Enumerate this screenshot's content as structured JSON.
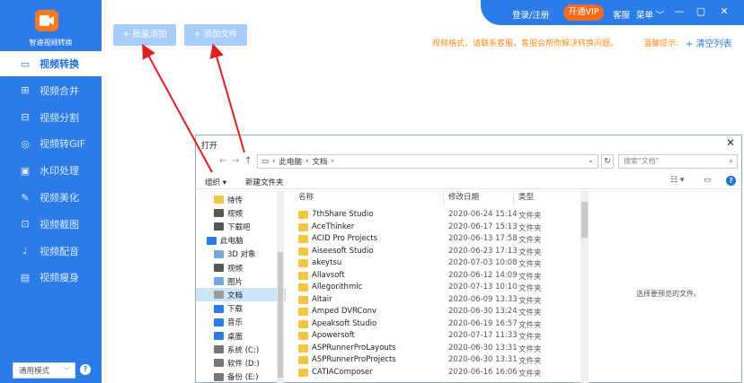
{
  "app": {
    "name": "智速视频转换",
    "nav": [
      {
        "label": "视频转换",
        "icon": "video-icon",
        "active": true
      },
      {
        "label": "视频合并",
        "icon": "merge-icon"
      },
      {
        "label": "视频分割",
        "icon": "split-icon"
      },
      {
        "label": "视频转GIF",
        "icon": "gif-icon"
      },
      {
        "label": "水印处理",
        "icon": "watermark-icon"
      },
      {
        "label": "视频美化",
        "icon": "beautify-icon"
      },
      {
        "label": "视频截图",
        "icon": "screenshot-icon"
      },
      {
        "label": "视频配音",
        "icon": "mic-icon"
      },
      {
        "label": "视频瘦身",
        "icon": "compress-icon"
      }
    ],
    "mode": "通用模式",
    "help": "?"
  },
  "topbar": {
    "login": "登录/注册",
    "vip": "开通VIP",
    "service": "客服",
    "menu": "菜单"
  },
  "main": {
    "batch_add": "+ 批量添加",
    "add_file": "+ 添加文件",
    "notice": "视频格式，请联系客服，客服会帮你解决转换问题。",
    "tip": "温馨提示:",
    "clear": "+ 清空列表"
  },
  "dialog": {
    "title": "打开",
    "path": [
      "此电脑",
      "文档"
    ],
    "search_placeholder": "搜索\"文档\"",
    "organize": "组织 ▾",
    "new_folder": "新建文件夹",
    "tree": [
      {
        "label": "待传",
        "color": "#f4c542"
      },
      {
        "label": "视频",
        "color": "#555"
      },
      {
        "label": "下载吧",
        "color": "#555"
      },
      {
        "label": "此电脑",
        "color": "#2c7ce8"
      },
      {
        "label": "3D 对象",
        "color": "#6fa8dc"
      },
      {
        "label": "视频",
        "color": "#555"
      },
      {
        "label": "图片",
        "color": "#6fa8dc"
      },
      {
        "label": "文档",
        "color": "#999",
        "selected": true
      },
      {
        "label": "下载",
        "color": "#2c7ce8"
      },
      {
        "label": "音乐",
        "color": "#2c7ce8"
      },
      {
        "label": "桌面",
        "color": "#2c7ce8"
      },
      {
        "label": "系统 (C:)",
        "color": "#777"
      },
      {
        "label": "软件 (D:)",
        "color": "#777"
      },
      {
        "label": "备份 (E:)",
        "color": "#777"
      }
    ],
    "columns": {
      "name": "名称",
      "date": "修改日期",
      "type": "类型"
    },
    "files": [
      {
        "name": "7thShare Studio",
        "date": "2020-06-24 15:14",
        "type": "文件夹"
      },
      {
        "name": "AceThinker",
        "date": "2020-06-17 15:13",
        "type": "文件夹"
      },
      {
        "name": "ACID Pro Projects",
        "date": "2020-06-13 17:58",
        "type": "文件夹"
      },
      {
        "name": "Aiseesoft Studio",
        "date": "2020-06-23 17:13",
        "type": "文件夹"
      },
      {
        "name": "akeytsu",
        "date": "2020-07-03 10:08",
        "type": "文件夹"
      },
      {
        "name": "Allavsoft",
        "date": "2020-06-12 14:09",
        "type": "文件夹"
      },
      {
        "name": "Allegorithmic",
        "date": "2020-07-13 10:10",
        "type": "文件夹"
      },
      {
        "name": "Altair",
        "date": "2020-06-09 13:33",
        "type": "文件夹"
      },
      {
        "name": "Amped DVRConv",
        "date": "2020-06-30 13:24",
        "type": "文件夹"
      },
      {
        "name": "Apeaksoft Studio",
        "date": "2020-06-19 16:57",
        "type": "文件夹"
      },
      {
        "name": "Apowersoft",
        "date": "2020-07-17 11:33",
        "type": "文件夹"
      },
      {
        "name": "ASPRunnerProLayouts",
        "date": "2020-06-30 13:31",
        "type": "文件夹"
      },
      {
        "name": "ASPRunnerProProjects",
        "date": "2020-06-30 13:31",
        "type": "文件夹"
      },
      {
        "name": "CATIAComposer",
        "date": "2020-06-16 16:06",
        "type": "文件夹"
      }
    ],
    "preview_text": "选择要预览的文件。"
  }
}
